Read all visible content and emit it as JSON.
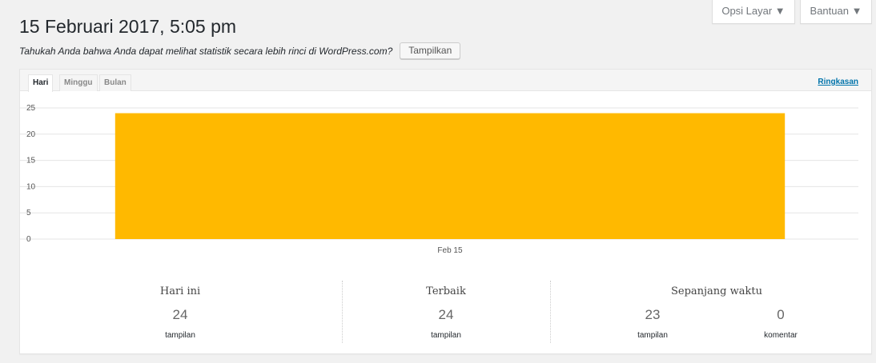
{
  "header": {
    "title": "15 Februari 2017, 5:05 pm",
    "screen_options_label": "Opsi Layar ▼",
    "help_label": "Bantuan ▼"
  },
  "notice": {
    "text": "Tahukah Anda bahwa Anda dapat melihat statistik secara lebih rinci di WordPress.com?",
    "button_label": "Tampilkan"
  },
  "tabs": [
    {
      "label": "Hari",
      "active": true
    },
    {
      "label": "Minggu",
      "active": false
    },
    {
      "label": "Bulan",
      "active": false
    }
  ],
  "summary_link": "Ringkasan",
  "chart_data": {
    "type": "bar",
    "categories": [
      "Feb 15"
    ],
    "values": [
      24
    ],
    "ylim": [
      0,
      25
    ],
    "yticks": [
      0,
      5,
      10,
      15,
      20,
      25
    ],
    "bar_color": "#ffb900",
    "grid": true
  },
  "stats": {
    "today": {
      "label": "Hari ini",
      "value": "24",
      "unit": "tampilan"
    },
    "best": {
      "label": "Terbaik",
      "value": "24",
      "unit": "tampilan"
    },
    "alltime": {
      "label": "Sepanjang waktu",
      "views": {
        "value": "23",
        "unit": "tampilan"
      },
      "comments": {
        "value": "0",
        "unit": "komentar"
      }
    }
  },
  "colors": {
    "accent": "#0073aa",
    "bar": "#ffb900",
    "background": "#f1f1f1"
  }
}
